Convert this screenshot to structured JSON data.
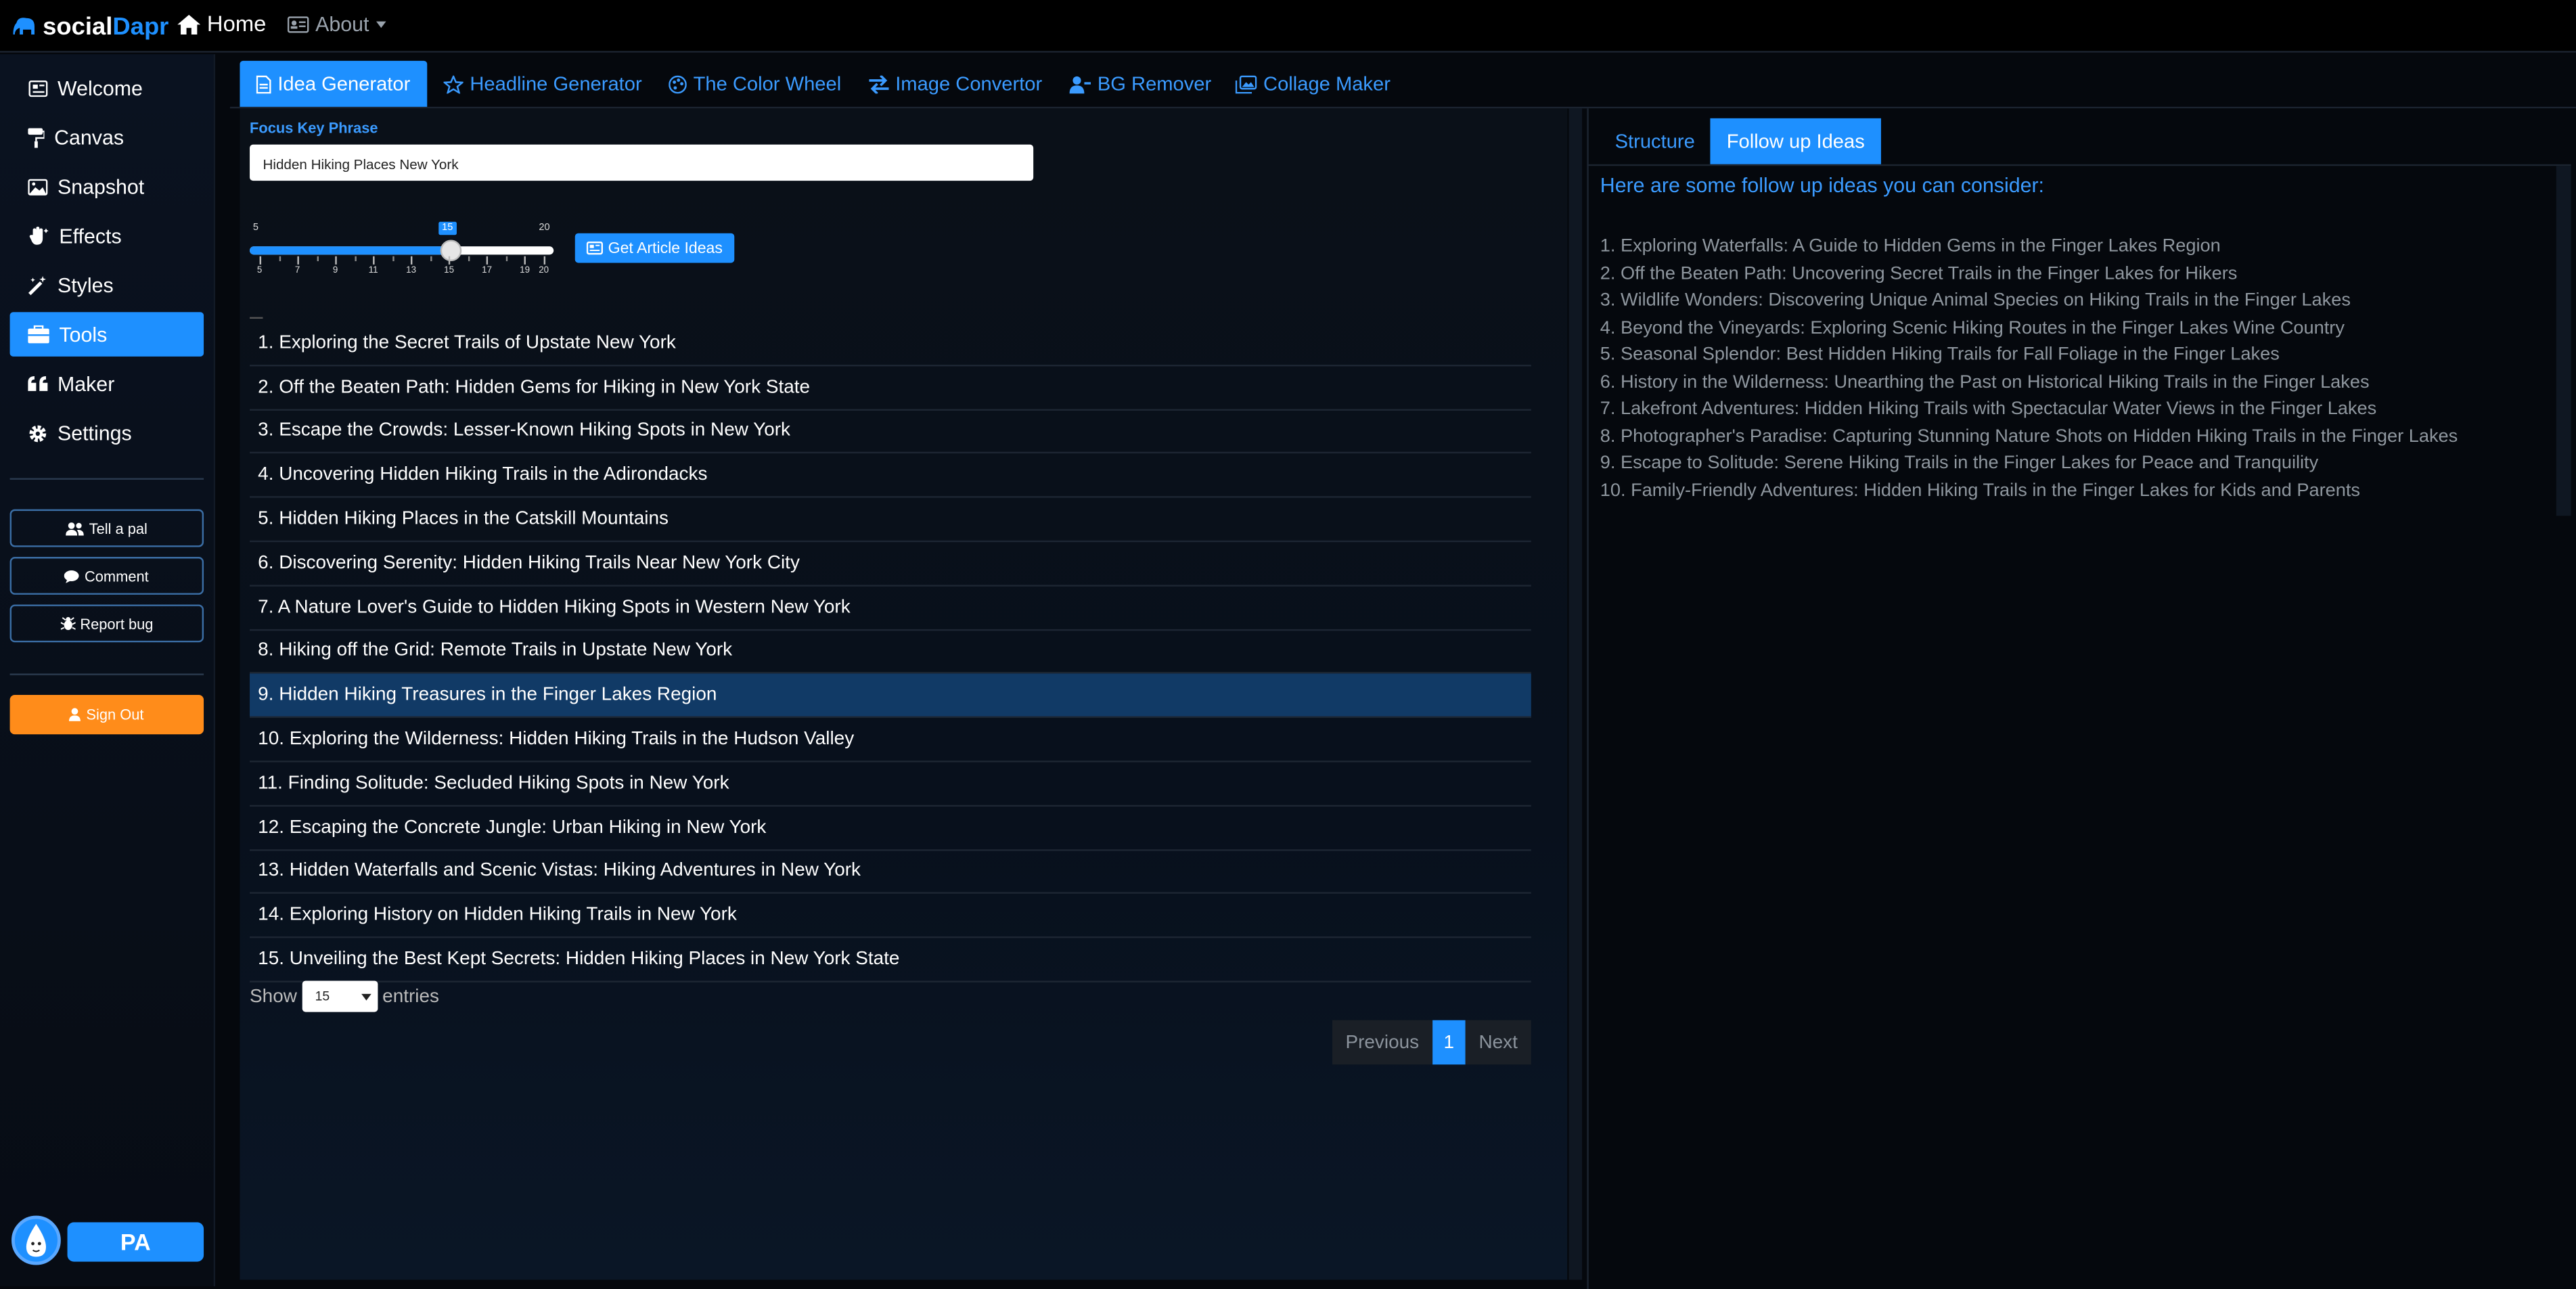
{
  "app": {
    "brand_part1": "social",
    "brand_part2": "Dapr",
    "nav_home": "Home",
    "nav_about": "About"
  },
  "sidebar": {
    "items": [
      {
        "label": "Welcome",
        "icon": "newspaper-icon"
      },
      {
        "label": "Canvas",
        "icon": "paint-roller-icon"
      },
      {
        "label": "Snapshot",
        "icon": "image-icon"
      },
      {
        "label": "Effects",
        "icon": "hand-sparkles-icon"
      },
      {
        "label": "Styles",
        "icon": "magic-wand-icon"
      },
      {
        "label": "Tools",
        "icon": "toolbox-icon",
        "active": true
      },
      {
        "label": "Maker",
        "icon": "quote-icon"
      },
      {
        "label": "Settings",
        "icon": "gear-icon"
      }
    ],
    "tell_a_pal": "Tell a pal",
    "comment": "Comment",
    "report_bug": "Report bug",
    "sign_out": "Sign Out",
    "user_initials": "PA"
  },
  "tabs": [
    {
      "label": "Idea Generator",
      "icon": "document-icon",
      "active": true
    },
    {
      "label": "Headline Generator",
      "icon": "star-icon"
    },
    {
      "label": "The Color Wheel",
      "icon": "palette-icon"
    },
    {
      "label": "Image Convertor",
      "icon": "swap-arrows-icon"
    },
    {
      "label": "BG Remover",
      "icon": "user-minus-icon"
    },
    {
      "label": "Collage Maker",
      "icon": "images-icon"
    }
  ],
  "form": {
    "focus_label": "Focus Key Phrase",
    "focus_value": "Hidden Hiking Places New York",
    "slider": {
      "min": 5,
      "max": 20,
      "value": 15,
      "min_label": "5",
      "max_label": "20",
      "value_label": "15",
      "tick_labels": [
        "5",
        "7",
        "9",
        "11",
        "13",
        "15",
        "17",
        "19",
        "20"
      ]
    },
    "get_ideas_label": "Get Article Ideas"
  },
  "ideas": [
    "1. Exploring the Secret Trails of Upstate New York",
    "2. Off the Beaten Path: Hidden Gems for Hiking in New York State",
    "3. Escape the Crowds: Lesser-Known Hiking Spots in New York",
    "4. Uncovering Hidden Hiking Trails in the Adirondacks",
    "5. Hidden Hiking Places in the Catskill Mountains",
    "6. Discovering Serenity: Hidden Hiking Trails Near New York City",
    "7. A Nature Lover's Guide to Hidden Hiking Spots in Western New York",
    "8. Hiking off the Grid: Remote Trails in Upstate New York",
    "9. Hidden Hiking Treasures in the Finger Lakes Region",
    "10. Exploring the Wilderness: Hidden Hiking Trails in the Hudson Valley",
    "11. Finding Solitude: Secluded Hiking Spots in New York",
    "12. Escaping the Concrete Jungle: Urban Hiking in New York",
    "13. Hidden Waterfalls and Scenic Vistas: Hiking Adventures in New York",
    "14. Exploring History on Hidden Hiking Trails in New York",
    "15. Unveiling the Best Kept Secrets: Hidden Hiking Places in New York State"
  ],
  "selected_idea_index": 8,
  "table_footer": {
    "show_label": "Show",
    "entries_value": "15",
    "entries_label": "entries",
    "previous": "Previous",
    "page": "1",
    "next": "Next"
  },
  "right_panel": {
    "tab_structure": "Structure",
    "tab_follow_up": "Follow up Ideas",
    "intro": "Here are some follow up ideas you can consider:",
    "follow_ups": [
      "1. Exploring Waterfalls: A Guide to Hidden Gems in the Finger Lakes Region",
      "2. Off the Beaten Path: Uncovering Secret Trails in the Finger Lakes for Hikers",
      "3. Wildlife Wonders: Discovering Unique Animal Species on Hiking Trails in the Finger Lakes",
      "4. Beyond the Vineyards: Exploring Scenic Hiking Routes in the Finger Lakes Wine Country",
      "5. Seasonal Splendor: Best Hidden Hiking Trails for Fall Foliage in the Finger Lakes",
      "6. History in the Wilderness: Unearthing the Past on Historical Hiking Trails in the Finger Lakes",
      "7. Lakefront Adventures: Hidden Hiking Trails with Spectacular Water Views in the Finger Lakes",
      "8. Photographer's Paradise: Capturing Stunning Nature Shots on Hidden Hiking Trails in the Finger Lakes",
      "9. Escape to Solitude: Serene Hiking Trails in the Finger Lakes for Peace and Tranquility",
      "10. Family-Friendly Adventures: Hidden Hiking Trails in the Finger Lakes for Kids and Parents"
    ]
  },
  "colors": {
    "accent": "#1e90ff",
    "signout": "#ff8c1a",
    "selected_row": "#113a66",
    "background": "#05080d"
  }
}
